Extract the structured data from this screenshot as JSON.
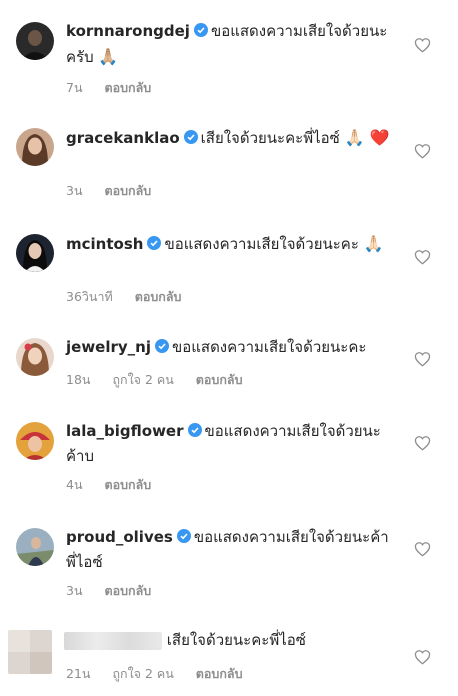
{
  "comments": [
    {
      "username": "kornnarongdej",
      "verified": true,
      "text": "ขอแสดงความเสียใจด้วยนะครับ",
      "emoji": "🙏🏼",
      "time": "7น",
      "likes": "",
      "reply_label": "ตอบกลับ"
    },
    {
      "username": "gracekanklao",
      "verified": true,
      "text": "เสียใจด้วยนะคะพี่ไอซ์",
      "emoji": "🙏🏻 ❤️",
      "time": "3น",
      "likes": "",
      "reply_label": "ตอบกลับ"
    },
    {
      "username": "mcintosh",
      "verified": true,
      "text": "ขอแสดงความเสียใจด้วยนะคะ",
      "emoji": "🙏🏻",
      "time": "36วินาที",
      "likes": "",
      "reply_label": "ตอบกลับ"
    },
    {
      "username": "jewelry_nj",
      "verified": true,
      "text": "ขอแสดงความเสียใจด้วยนะคะ",
      "emoji": "",
      "time": "18น",
      "likes": "ถูกใจ 2 คน",
      "reply_label": "ตอบกลับ"
    },
    {
      "username": "lala_bigflower",
      "verified": true,
      "text": "ขอแสดงความเสียใจด้วยนะค้าบ",
      "emoji": "",
      "time": "4น",
      "likes": "",
      "reply_label": "ตอบกลับ"
    },
    {
      "username": "proud_olives",
      "verified": true,
      "text": "ขอแสดงความเสียใจด้วยนะค้าพี่ไอซ์",
      "emoji": "",
      "time": "3น",
      "likes": "",
      "reply_label": "ตอบกลับ"
    },
    {
      "username": "",
      "verified": false,
      "text": "เสียใจด้วยนะคะพี่ไอซ์",
      "emoji": "",
      "time": "21น",
      "likes": "ถูกใจ 2 คน",
      "reply_label": "ตอบกลับ"
    }
  ],
  "icons": {
    "verified": "verified-badge-icon",
    "like": "heart-icon"
  },
  "colors": {
    "verified_blue": "#3897f0",
    "meta_gray": "#8e8e8e",
    "heart_stroke": "#8e8e8e"
  }
}
